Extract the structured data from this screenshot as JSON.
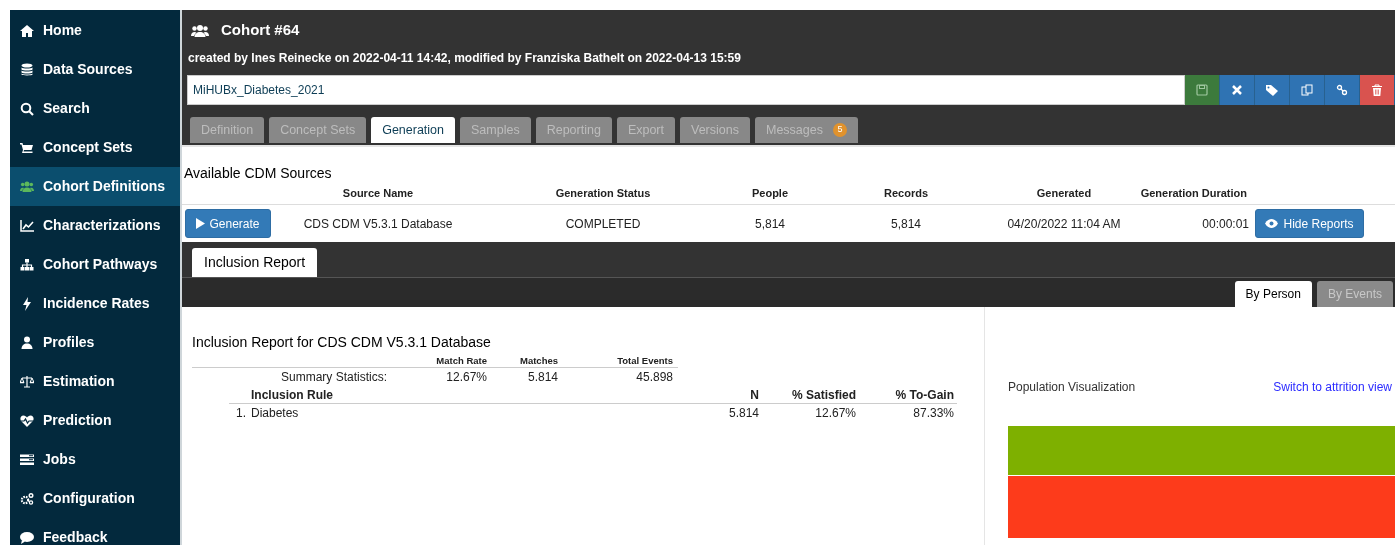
{
  "sidebar": {
    "items": [
      {
        "label": "Home",
        "selected": false
      },
      {
        "label": "Data Sources",
        "selected": false
      },
      {
        "label": "Search",
        "selected": false
      },
      {
        "label": "Concept Sets",
        "selected": false
      },
      {
        "label": "Cohort Definitions",
        "selected": true
      },
      {
        "label": "Characterizations",
        "selected": false
      },
      {
        "label": "Cohort Pathways",
        "selected": false
      },
      {
        "label": "Incidence Rates",
        "selected": false
      },
      {
        "label": "Profiles",
        "selected": false
      },
      {
        "label": "Estimation",
        "selected": false
      },
      {
        "label": "Prediction",
        "selected": false
      },
      {
        "label": "Jobs",
        "selected": false
      },
      {
        "label": "Configuration",
        "selected": false
      },
      {
        "label": "Feedback",
        "selected": false
      }
    ]
  },
  "header": {
    "title": "Cohort #64",
    "meta": "created by Ines Reinecke on 2022-04-11 14:42, modified by Franziska Bathelt on 2022-04-13 15:59",
    "name_field": {
      "value": "MiHUBx_Diabetes_2021"
    }
  },
  "tabs": [
    {
      "label": "Definition",
      "selected": false
    },
    {
      "label": "Concept Sets",
      "selected": false
    },
    {
      "label": "Generation",
      "selected": true
    },
    {
      "label": "Samples",
      "selected": false
    },
    {
      "label": "Reporting",
      "selected": false
    },
    {
      "label": "Export",
      "selected": false
    },
    {
      "label": "Versions",
      "selected": false
    },
    {
      "label": "Messages",
      "selected": false,
      "badge": "5"
    }
  ],
  "sources": {
    "title": "Available CDM Sources",
    "columns": [
      "Source Name",
      "Generation Status",
      "People",
      "Records",
      "Generated",
      "Generation Duration"
    ],
    "rows": [
      {
        "action": "Generate",
        "cells": [
          "CDS CDM V5.3.1 Database",
          "COMPLETED",
          "5,814",
          "5,814",
          "04/20/2022 11:04 AM",
          "00:00:01"
        ],
        "toggle": "Hide Reports"
      }
    ]
  },
  "report_tabs": [
    {
      "label": "Inclusion Report",
      "selected": true
    }
  ],
  "view_tabs": [
    {
      "label": "By Person",
      "selected": true
    },
    {
      "label": "By Events",
      "selected": false
    }
  ],
  "report": {
    "title": "Inclusion Report for CDS CDM V5.3.1 Database",
    "summary": {
      "columns": [
        "Match Rate",
        "Matches",
        "Total Events"
      ],
      "label": "Summary Statistics:",
      "values": [
        "12.67%",
        "5.814",
        "45.898"
      ]
    },
    "rules": {
      "columns": [
        "Inclusion Rule",
        "N",
        "% Satisfied",
        "% To-Gain"
      ],
      "rows": [
        {
          "number": "1.",
          "name": "Diabetes",
          "values": [
            "5.814",
            "12.67%",
            "87.33%"
          ]
        }
      ]
    }
  },
  "visualization": {
    "title": "Population Visualization",
    "link": "Switch to attrition view"
  }
}
